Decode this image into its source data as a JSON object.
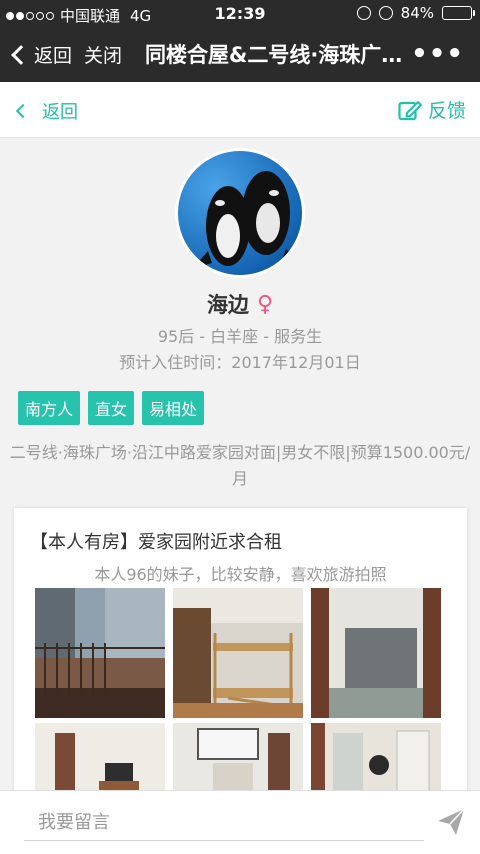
{
  "status_bar": {
    "carrier": "中国联通",
    "network": "4G",
    "time": "12:39",
    "battery": "84%",
    "battery_level": 0.84
  },
  "nav": {
    "back_label": "返回",
    "close_label": "关闭",
    "title": "同楼合屋&二号线·海珠广场·沿江中路爱家园对面",
    "more_label": "•••"
  },
  "subheader": {
    "back_label": "返回",
    "feedback_label": "反馈"
  },
  "profile": {
    "name": "海边",
    "gender_symbol": "♀",
    "meta": "95后 - 白羊座 - 服务生",
    "move_in": "预计入住时间：2017年12月01日",
    "tags": [
      "南方人",
      "直女",
      "易相处"
    ],
    "description": "二号线·海珠广场·沿江中路爱家园对面|男女不限|预算1500.00元/月"
  },
  "card": {
    "title": "【本人有房】爱家园附近求合租",
    "subtitle": "本人96的妹子，比较安静，喜欢旅游拍照",
    "photos": [
      "balcony-photo",
      "bunk-bed-photo",
      "room-mattress-photo",
      "living-room-photo",
      "window-photo",
      "kitchen-photo"
    ]
  },
  "compose": {
    "placeholder": "我要留言"
  },
  "colors": {
    "accent": "#1fc1a8",
    "tag_bg": "#27c3ad",
    "gender": "#f2557f",
    "navbar": "#2b2b2b"
  }
}
